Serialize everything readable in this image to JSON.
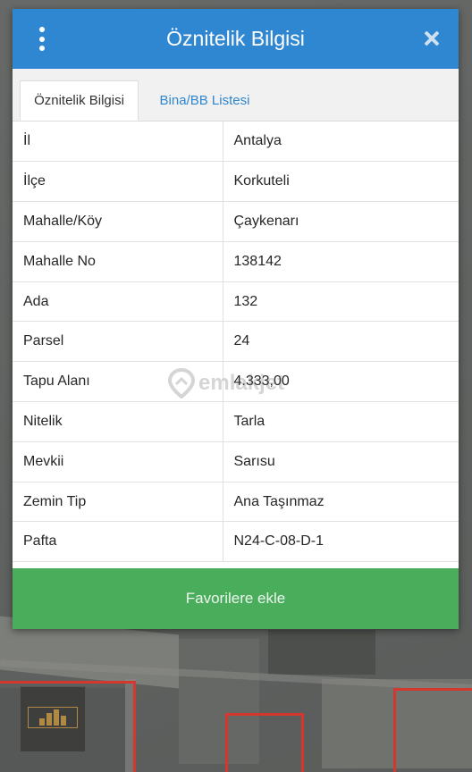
{
  "dialog": {
    "title": "Öznitelik Bilgisi",
    "tabs": [
      {
        "label": "Öznitelik Bilgisi",
        "active": true
      },
      {
        "label": "Bina/BB Listesi",
        "active": false
      }
    ],
    "rows": [
      {
        "key": "İl",
        "value": "Antalya"
      },
      {
        "key": "İlçe",
        "value": "Korkuteli"
      },
      {
        "key": "Mahalle/Köy",
        "value": "Çaykenarı"
      },
      {
        "key": "Mahalle No",
        "value": "138142"
      },
      {
        "key": "Ada",
        "value": "132"
      },
      {
        "key": "Parsel",
        "value": "24"
      },
      {
        "key": "Tapu Alanı",
        "value": "4.333,00"
      },
      {
        "key": "Nitelik",
        "value": "Tarla"
      },
      {
        "key": "Mevkii",
        "value": "Sarısu"
      },
      {
        "key": "Zemin Tip",
        "value": "Ana Taşınmaz"
      },
      {
        "key": "Pafta",
        "value": "N24-C-08-D-1"
      }
    ],
    "favorite_button": "Favorilere ekle"
  },
  "watermark": "emlakjet",
  "icons": {
    "menu": "kebab-menu-icon",
    "close": "close-icon",
    "watermark": "location-pin-icon"
  },
  "colors": {
    "header": "#2f86d1",
    "tab_link": "#2f86d1",
    "favorite_button": "#49ad5b",
    "parcel_outline": "#d4372d"
  }
}
